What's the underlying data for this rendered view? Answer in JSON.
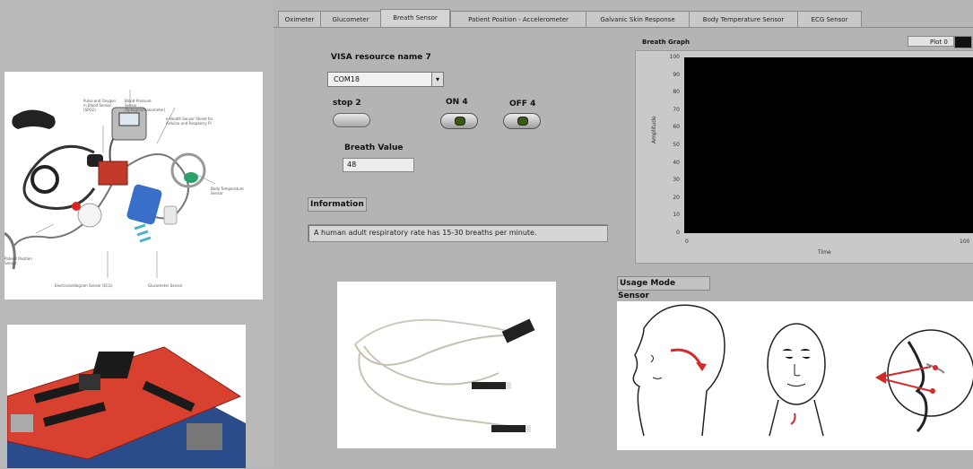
{
  "tabs": [
    {
      "label": "Oximeter",
      "active": false
    },
    {
      "label": "Glucometer",
      "active": false
    },
    {
      "label": "Breath Sensor",
      "active": true
    },
    {
      "label": "Patient Position - Accelerometer",
      "active": false
    },
    {
      "label": "Galvanic Skin Response",
      "active": false
    },
    {
      "label": "Body Temperature Sensor",
      "active": false
    },
    {
      "label": "ECG Sensor",
      "active": false
    }
  ],
  "visa": {
    "label": "VISA resource name 7",
    "value": "COM18"
  },
  "controls": {
    "stop_label": "stop 2",
    "on_label": "ON 4",
    "off_label": "OFF 4"
  },
  "breath": {
    "label": "Breath Value",
    "value": "48"
  },
  "information": {
    "label": "Information",
    "text": "A human adult respiratory rate has 15-30 breaths per minute."
  },
  "graph": {
    "title": "Breath Graph",
    "legend": "Plot 0",
    "ylabel": "Amplitude",
    "xlabel": "Time",
    "yticks": [
      "100",
      "90",
      "80",
      "70",
      "60",
      "50",
      "40",
      "30",
      "20",
      "10",
      "0"
    ],
    "xticks": [
      "0",
      "100"
    ]
  },
  "usage": {
    "label": "Usage Mode Sensor"
  },
  "kit_labels": {
    "l1": "Pulse and Oxygen in Blood Sensor (SPO2)",
    "l2": "Blood Pressure Sensor (Sphygmomanometer)",
    "l3": "e-Health Sensor Shield for Arduino and Raspberry Pi",
    "l4": "Body Temperature Sensor",
    "l5": "Patient Position Sensor",
    "l6": "Electrocardiogram Sensor (ECG)",
    "l7": "Glucometer Sensor"
  },
  "colors": {
    "plot_bg": "#000000",
    "panel_bg": "#b4b4b4",
    "board_red": "#d8412f",
    "usage_arrow": "#d42a2a"
  }
}
